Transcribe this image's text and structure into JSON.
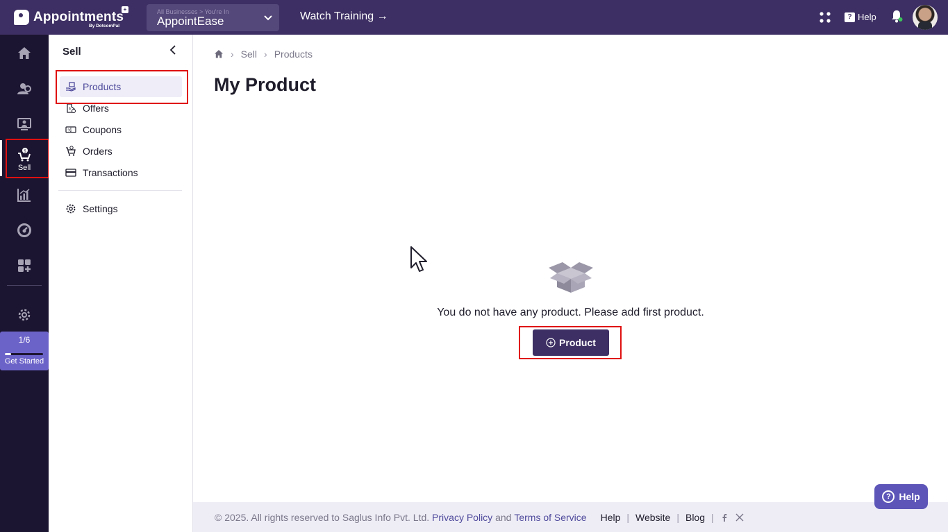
{
  "app": {
    "name": "Appointments",
    "badge": "+",
    "by": "By DotcomPal"
  },
  "business_selector": {
    "caption": "All Businesses > You're In",
    "current": "AppointEase"
  },
  "topbar": {
    "watch_training": "Watch Training →",
    "help_label": "Help"
  },
  "rail": {
    "sell_label": "Sell",
    "get_started": {
      "step": "1/6",
      "label": "Get Started",
      "progress_fraction": 0.167
    }
  },
  "sidebar": {
    "title": "Sell",
    "items": [
      {
        "label": "Products",
        "icon": "hand-box-icon",
        "active": true
      },
      {
        "label": "Offers",
        "icon": "offer-tag-icon"
      },
      {
        "label": "Coupons",
        "icon": "coupon-icon"
      },
      {
        "label": "Orders",
        "icon": "orders-icon"
      },
      {
        "label": "Transactions",
        "icon": "card-icon"
      }
    ],
    "settings_label": "Settings"
  },
  "breadcrumb": [
    "Sell",
    "Products"
  ],
  "page": {
    "title": "My Product",
    "empty_message": "You do not have any product. Please add first product.",
    "add_button": "Product"
  },
  "footer": {
    "copyright": "©  2025. All rights reserved to Saglus Info Pvt. Ltd.",
    "privacy": "Privacy Policy",
    "and": "and",
    "terms": "Terms of Service",
    "links": [
      "Help",
      "Website",
      "Blog"
    ]
  },
  "floating_help": "Help",
  "colors": {
    "topbar": "#3d2f63",
    "rail": "#1c1531",
    "accent": "#5d56b8",
    "highlight": "#e01010"
  }
}
